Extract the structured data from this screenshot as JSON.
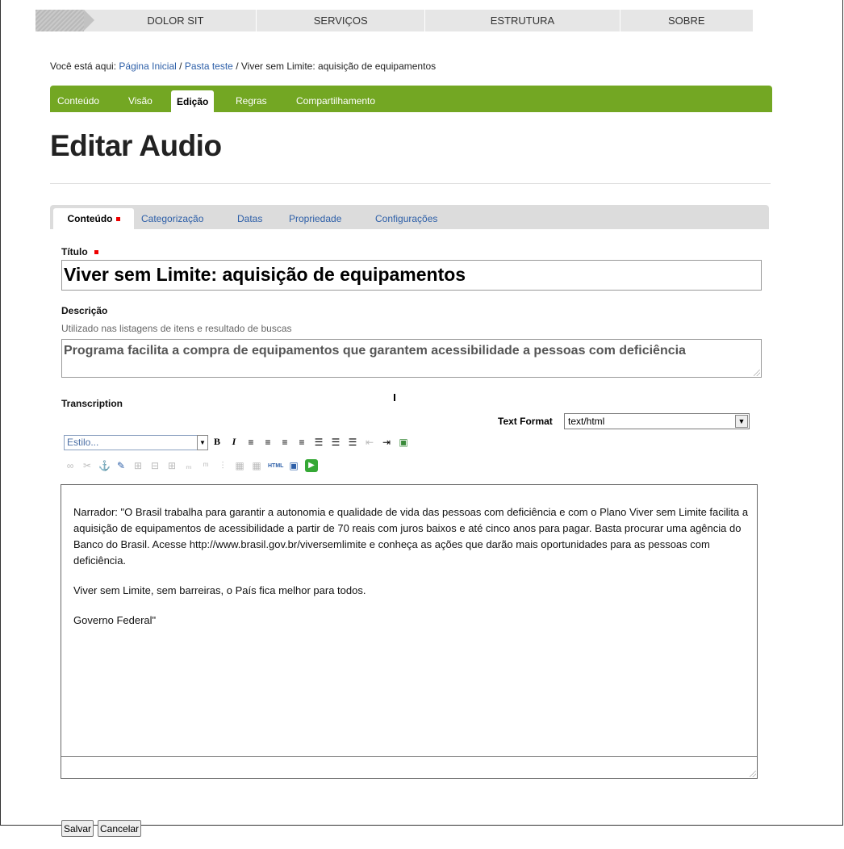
{
  "topnav": {
    "items": [
      "DOLOR SIT",
      "SERVIÇOS",
      "ESTRUTURA",
      "SOBRE"
    ]
  },
  "breadcrumb": {
    "prefix": "Você está aqui: ",
    "home": "Página Inicial",
    "sep": " / ",
    "folder": "Pasta teste",
    "current": "Viver sem Limite: aquisição de equipamentos"
  },
  "content_tabs": [
    "Conteúdo",
    "Visão",
    "Edição",
    "Regras",
    "Compartilhamento"
  ],
  "page_title": "Editar Audio",
  "form_tabs": [
    "Conteúdo",
    "Categorização",
    "Datas",
    "Propriedade",
    "Configurações"
  ],
  "fields": {
    "title_label": "Título",
    "title_value": "Viver sem Limite: aquisição de equipamentos",
    "desc_label": "Descrição",
    "desc_help": "Utilizado nas listagens de itens e resultado de buscas",
    "desc_value": "Programa facilita a compra de equipamentos que garantem acessibilidade a pessoas com deficiência",
    "transcription_label": "Transcription",
    "text_format_label": "Text Format",
    "text_format_value": "text/html",
    "style_placeholder": "Estilo..."
  },
  "editor": {
    "paragraphs": [
      "Narrador: \"O Brasil trabalha para garantir a autonomia e qualidade de vida das pessoas com deficiência e com o  Plano Viver sem Limite facilita a aquisição de equipamentos de acessibilidade a partir de 70 reais com juros baixos e até cinco anos para pagar. Basta procurar uma agência do Banco do Brasil. Acesse http://www.brasil.gov.br/viversemlimite e conheça as ações que darão mais oportunidades para as pessoas com deficiência.",
      "Viver sem Limite, sem barreiras, o País fica melhor para todos.",
      "Governo Federal\""
    ]
  },
  "buttons": {
    "save": "Salvar",
    "cancel": "Cancelar"
  },
  "colors": {
    "green": "#73a723",
    "link": "#2d5fa8",
    "required": "#e00000"
  }
}
